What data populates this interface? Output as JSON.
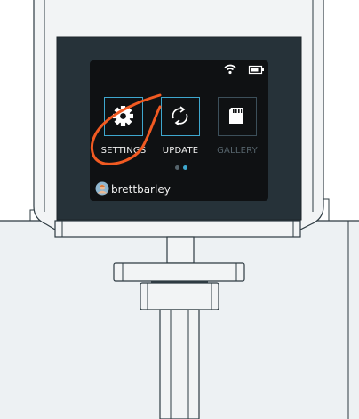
{
  "screen": {
    "apps": [
      {
        "label": "SETTINGS",
        "icon": "gear-icon",
        "state": "selected"
      },
      {
        "label": "UPDATE",
        "icon": "refresh-icon",
        "state": "normal"
      },
      {
        "label": "GALLERY",
        "icon": "sd-card-icon",
        "state": "disabled"
      }
    ],
    "page_indicator": {
      "pages": 2,
      "current": 2
    },
    "status": {
      "wifi": "wifi-icon",
      "battery": "battery-icon"
    },
    "user": {
      "name": "brettbarley",
      "avatar": "avatar-icon"
    }
  },
  "colors": {
    "accent": "#3ea7ce",
    "highlight_circle": "#f15a22",
    "screen_bg": "#0f1113",
    "device_body": "#f2f4f5",
    "outline": "#2e3b42",
    "floor": "#edf1f3",
    "disabled_text": "#56646c"
  }
}
